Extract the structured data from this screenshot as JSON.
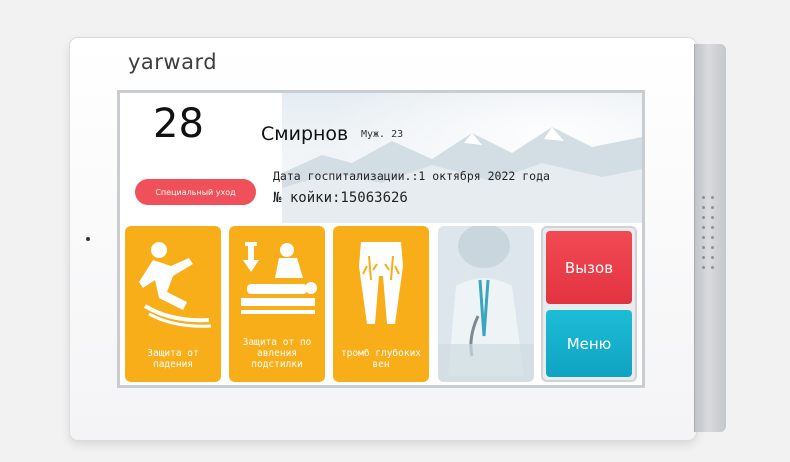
{
  "device": {
    "brand": "yarward"
  },
  "header": {
    "bed_number": "28",
    "patient_name": "Смирнов",
    "patient_meta": "Муж. 23",
    "admission": "Дата госпитализации.:1 октября 2022 года",
    "bed_id": "№ койки:15063626",
    "care_badge": "Специальный уход"
  },
  "tiles": [
    {
      "label": "Защита от падения",
      "icon": "fall-icon"
    },
    {
      "label": "Защита от по авления подстилки",
      "icon": "pressure-ulcer-icon"
    },
    {
      "label": "тромб глубоких вен",
      "icon": "legs-veins-icon"
    }
  ],
  "buttons": {
    "call": "Вызов",
    "menu": "Меню"
  },
  "colors": {
    "tile": "#f7ae18",
    "call": "#e7353f",
    "menu": "#14b0cd",
    "badge": "#f0505a"
  }
}
